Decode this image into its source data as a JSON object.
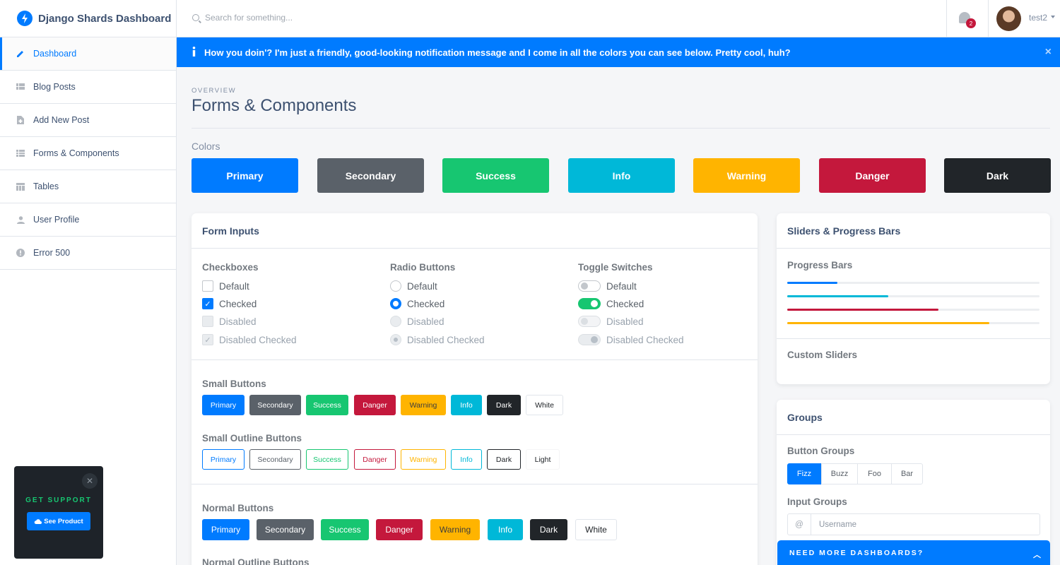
{
  "brand": {
    "name": "Django Shards Dashboard"
  },
  "sidebar": {
    "items": [
      {
        "label": "Dashboard",
        "icon": "edit-icon"
      },
      {
        "label": "Blog Posts",
        "icon": "view-module-icon"
      },
      {
        "label": "Add New Post",
        "icon": "note-add-icon"
      },
      {
        "label": "Forms & Components",
        "icon": "view-module-icon"
      },
      {
        "label": "Tables",
        "icon": "table-chart-icon"
      },
      {
        "label": "User Profile",
        "icon": "person-icon"
      },
      {
        "label": "Error 500",
        "icon": "error-icon"
      }
    ],
    "support": {
      "title": "GET SUPPORT",
      "button": "See Product"
    }
  },
  "topbar": {
    "search_placeholder": "Search for something...",
    "notification_count": "2",
    "username": "test2"
  },
  "alert": {
    "message": "How you doin'? I'm just a friendly, good-looking notification message and I come in all the colors you can see below. Pretty cool, huh?",
    "close": "×"
  },
  "page": {
    "subtitle": "OVERVIEW",
    "title": "Forms & Components"
  },
  "colors": {
    "label": "Colors",
    "swatches": [
      {
        "label": "Primary",
        "color": "#007bff"
      },
      {
        "label": "Secondary",
        "color": "#5a6169"
      },
      {
        "label": "Success",
        "color": "#17c671"
      },
      {
        "label": "Info",
        "color": "#00b8d8"
      },
      {
        "label": "Warning",
        "color": "#ffb400"
      },
      {
        "label": "Danger",
        "color": "#c4183c"
      },
      {
        "label": "Dark",
        "color": "#212529"
      }
    ]
  },
  "form_inputs": {
    "title": "Form Inputs",
    "checkboxes": {
      "label": "Checkboxes",
      "options": [
        "Default",
        "Checked",
        "Disabled",
        "Disabled Checked"
      ]
    },
    "radios": {
      "label": "Radio Buttons",
      "options": [
        "Default",
        "Checked",
        "Disabled",
        "Disabled Checked"
      ]
    },
    "toggles": {
      "label": "Toggle Switches",
      "options": [
        "Default",
        "Checked",
        "Disabled",
        "Disabled Checked"
      ]
    },
    "small_buttons": {
      "label": "Small Buttons",
      "items": [
        "Primary",
        "Secondary",
        "Success",
        "Danger",
        "Warning",
        "Info",
        "Dark",
        "White"
      ]
    },
    "small_outline": {
      "label": "Small Outline Buttons",
      "items": [
        "Primary",
        "Secondary",
        "Success",
        "Danger",
        "Warning",
        "Info",
        "Dark",
        "Light"
      ]
    },
    "normal_buttons": {
      "label": "Normal Buttons",
      "items": [
        "Primary",
        "Secondary",
        "Success",
        "Danger",
        "Warning",
        "Info",
        "Dark",
        "White"
      ]
    },
    "normal_outline": {
      "label": "Normal Outline Buttons"
    }
  },
  "sliders": {
    "title": "Sliders & Progress Bars",
    "progress_label": "Progress Bars",
    "progress": [
      {
        "value": 0.2,
        "color": "#007bff"
      },
      {
        "value": 0.4,
        "color": "#00b8d8"
      },
      {
        "value": 0.6,
        "color": "#c4183c"
      },
      {
        "value": 0.8,
        "color": "#ffb400"
      }
    ],
    "custom_label": "Custom Sliders"
  },
  "groups": {
    "title": "Groups",
    "button_groups_label": "Button Groups",
    "button_group": [
      "Fizz",
      "Buzz",
      "Foo",
      "Bar"
    ],
    "input_groups_label": "Input Groups",
    "input_addon": "@",
    "input_placeholder": "Username"
  },
  "promo": {
    "label": "NEED MORE DASHBOARDS?"
  }
}
